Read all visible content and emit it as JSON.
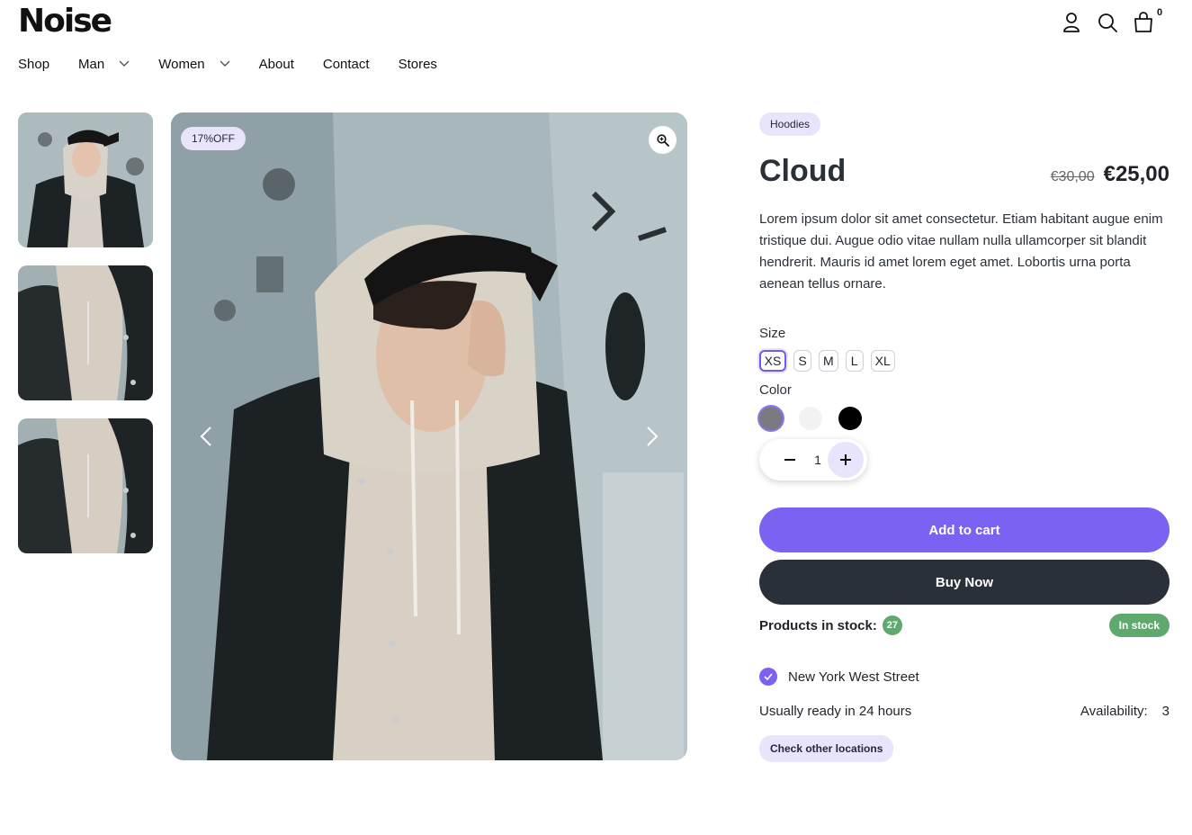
{
  "header": {
    "logo": "Noise",
    "cart_count": "0",
    "icons": [
      "user-icon",
      "search-icon",
      "cart-icon"
    ]
  },
  "nav": {
    "items": [
      {
        "label": "Shop",
        "has_dropdown": false
      },
      {
        "label": "Man",
        "has_dropdown": true
      },
      {
        "label": "Women",
        "has_dropdown": true
      },
      {
        "label": "About",
        "has_dropdown": false
      },
      {
        "label": "Contact",
        "has_dropdown": false
      },
      {
        "label": "Stores",
        "has_dropdown": false
      }
    ]
  },
  "gallery": {
    "badge": "17%OFF",
    "thumbnails": [
      "hooded-man-portrait",
      "hoodie-detail",
      "hoodie-detail"
    ]
  },
  "product": {
    "category": "Hoodies",
    "title": "Cloud",
    "old_price": "€30,00",
    "price": "€25,00",
    "description": "Lorem ipsum dolor sit amet consectetur. Etiam habitant augue enim tristique dui. Augue odio vitae nullam nulla ullamcorper sit blandit hendrerit. Mauris id amet lorem eget amet. Lobortis urna porta aenean tellus ornare.",
    "size_label": "Size",
    "sizes": [
      "XS",
      "S",
      "M",
      "L",
      "XL"
    ],
    "selected_size": "XS",
    "color_label": "Color",
    "colors": [
      "#7a7a80",
      "#f2f2f2",
      "#000000"
    ],
    "selected_color": "#7a7a80",
    "quantity": "1",
    "add_to_cart": "Add to cart",
    "buy_now": "Buy Now",
    "stock_label": "Products in stock:",
    "stock_count": "27",
    "stock_status": "In stock",
    "store_name": "New York West Street",
    "ready_text": "Usually ready in 24 hours",
    "availability_label": "Availability:",
    "availability_value": "3",
    "other_locations": "Check other locations"
  },
  "colors": {
    "accent": "#7c61f3",
    "dark": "#2a3038",
    "tag_bg": "#e7e4fb",
    "stock_green": "#5eaa6e"
  }
}
